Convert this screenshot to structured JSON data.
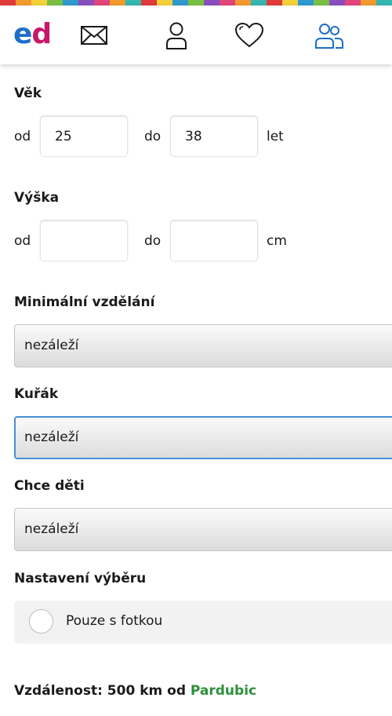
{
  "brand": {
    "logo_e": "e",
    "logo_d": "d",
    "stripe_colors": [
      "#e23b3b",
      "#f29a2e",
      "#f6d23a",
      "#7ac143",
      "#2e9ad0",
      "#8a4fbf",
      "#e2457a",
      "#f29a2e",
      "#36b6b0",
      "#e23b3b",
      "#f6d23a",
      "#2e9ad0",
      "#7ac143",
      "#8a4fbf",
      "#e2457a",
      "#f29a2e",
      "#36b6b0",
      "#e23b3b",
      "#f6d23a",
      "#2e9ad0",
      "#7ac143",
      "#8a4fbf",
      "#e2457a",
      "#f29a2e",
      "#36b6b0"
    ]
  },
  "nav": {
    "icons": [
      "mail-icon",
      "profile-icon",
      "heart-icon",
      "people-icon"
    ],
    "active_color": "#1e6fc9"
  },
  "age": {
    "title": "Věk",
    "from_label": "od",
    "from_value": "25",
    "to_label": "do",
    "to_value": "38",
    "unit": "let"
  },
  "height": {
    "title": "Výška",
    "from_label": "od",
    "from_value": "",
    "to_label": "do",
    "to_value": "",
    "unit": "cm"
  },
  "education": {
    "title": "Minimální vzdělání",
    "selected": "nezáleží"
  },
  "smoker": {
    "title": "Kuřák",
    "selected": "nezáleží"
  },
  "children": {
    "title": "Chce děti",
    "selected": "nezáleží"
  },
  "selection": {
    "title": "Nastavení výběru",
    "photo_only_label": "Pouze s fotkou",
    "photo_only_checked": false
  },
  "distance": {
    "prefix": "Vzdálenost: 500 km od",
    "city": "Pardubic",
    "city_color": "#2e8f3a"
  }
}
